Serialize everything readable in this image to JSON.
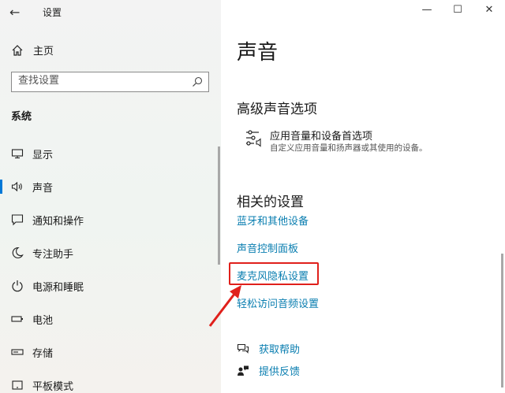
{
  "window": {
    "title": "设置",
    "back_icon": "back-arrow-icon",
    "controls": {
      "minimize": "—",
      "maximize": "☐",
      "close": "✕"
    }
  },
  "sidebar": {
    "home_label": "主页",
    "search_placeholder": "查找设置",
    "section_label": "系统",
    "items": [
      {
        "label": "显示",
        "icon": "monitor-icon",
        "active": false
      },
      {
        "label": "声音",
        "icon": "speaker-icon",
        "active": true
      },
      {
        "label": "通知和操作",
        "icon": "notification-icon",
        "active": false
      },
      {
        "label": "专注助手",
        "icon": "moon-icon",
        "active": false
      },
      {
        "label": "电源和睡眠",
        "icon": "power-icon",
        "active": false
      },
      {
        "label": "电池",
        "icon": "battery-icon",
        "active": false
      },
      {
        "label": "存储",
        "icon": "storage-icon",
        "active": false
      },
      {
        "label": "平板模式",
        "icon": "tablet-icon",
        "active": false
      }
    ]
  },
  "main": {
    "title": "声音",
    "advanced": {
      "heading": "高级声音选项",
      "item_title": "应用音量和设备首选项",
      "item_desc": "自定义应用音量和扬声器或其使用的设备。"
    },
    "related": {
      "heading": "相关的设置",
      "links": [
        "蓝牙和其他设备",
        "声音控制面板",
        "麦克风隐私设置",
        "轻松访问音频设置"
      ]
    },
    "help": {
      "get_help": "获取帮助",
      "feedback": "提供反馈"
    }
  },
  "colors": {
    "accent": "#0078d7",
    "link": "#0a7eb0",
    "highlight": "#e0201b"
  }
}
